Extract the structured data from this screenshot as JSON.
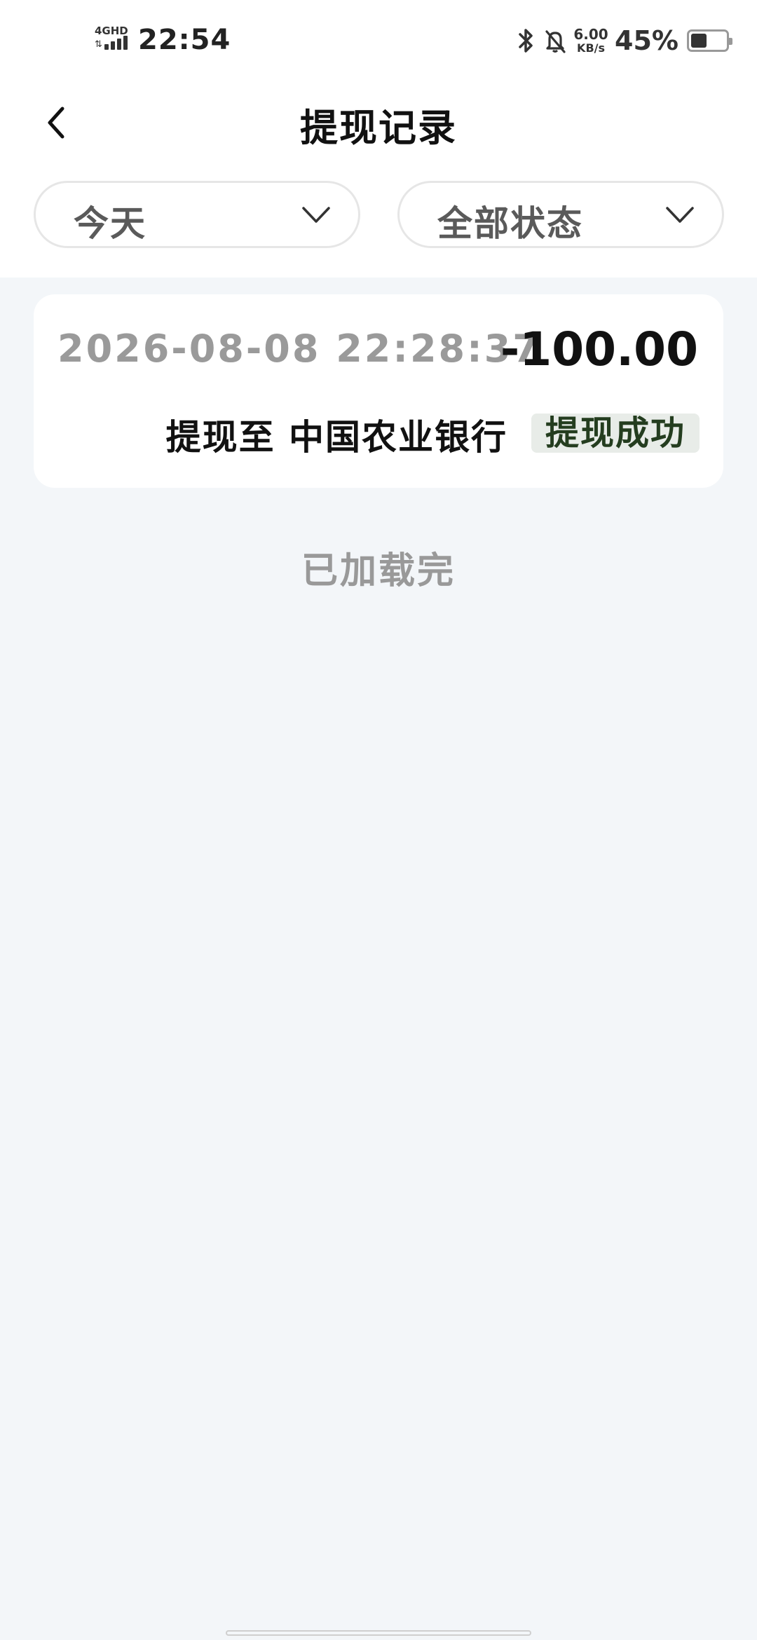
{
  "status_bar": {
    "network_label": "4GHD",
    "time": "22:54",
    "net_speed_value": "6.00",
    "net_speed_unit": "KB/s",
    "battery_percent": "45%",
    "battery_level": 0.45,
    "icons": [
      "signal-icon",
      "bluetooth-icon",
      "mute-bell-icon",
      "battery-icon"
    ]
  },
  "nav": {
    "title": "提现记录",
    "back_icon": "chevron-left-icon"
  },
  "filters": {
    "date": {
      "selected": "今天",
      "icon": "chevron-down-icon"
    },
    "status": {
      "selected": "全部状态",
      "icon": "chevron-down-icon"
    }
  },
  "records": [
    {
      "time": "2026-08-08 22:28:37",
      "amount": "-100.00",
      "destination": "提现至 中国农业银行",
      "status": "提现成功"
    }
  ],
  "list_footer": "已加载完",
  "colors": {
    "page_background": "#f3f6f9",
    "header_background": "#ffffff",
    "status_success_text": "#243d1f",
    "status_success_bg": "#e8ece8"
  }
}
